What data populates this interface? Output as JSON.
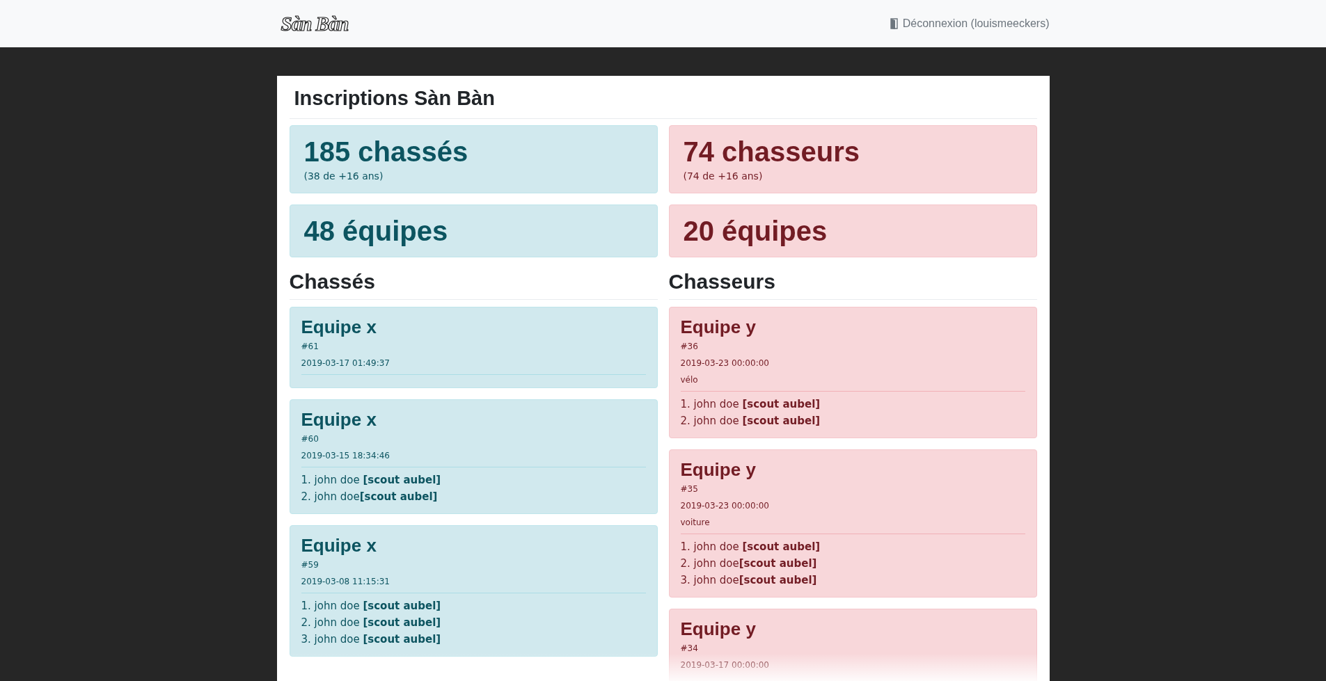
{
  "navbar": {
    "logo": "Sàn Bàn",
    "logout": "Déconnexion (louismeeckers)"
  },
  "page": {
    "title": "Inscriptions Sàn Bàn"
  },
  "columns": [
    {
      "kind": "info",
      "stats": [
        {
          "value": "185 chassés",
          "note": "(38 de +16 ans)"
        },
        {
          "value": "48 équipes"
        }
      ],
      "heading": "Chassés",
      "teams": [
        {
          "name": "Equipe x",
          "number": "#61",
          "date": "2019-03-17 01:49:37"
        },
        {
          "name": "Equipe x",
          "number": "#60",
          "date": "2019-03-15 18:34:46",
          "members": [
            "1. john doe **[scout aubel]**",
            "2. john doe**[scout aubel]**"
          ]
        },
        {
          "name": "Equipe x",
          "number": "#59",
          "date": "2019-03-08 11:15:31",
          "members": [
            "1. john doe **[scout aubel]**",
            "2. john doe **[scout aubel]**",
            "3. john doe **[scout aubel]**"
          ]
        }
      ]
    },
    {
      "kind": "danger",
      "stats": [
        {
          "value": "74 chasseurs",
          "note": "(74 de +16 ans)"
        },
        {
          "value": "20 équipes"
        }
      ],
      "heading": "Chasseurs",
      "teams": [
        {
          "name": "Equipe y",
          "number": "#36",
          "date": "2019-03-23 00:00:00",
          "vehicle": "vélo",
          "members": [
            "1. john doe **[scout aubel]**",
            "2. john doe **[scout aubel]**"
          ]
        },
        {
          "name": "Equipe y",
          "number": "#35",
          "date": "2019-03-23 00:00:00",
          "vehicle": "voiture",
          "members": [
            "1. john doe **[scout aubel]**",
            "2. john doe**[scout aubel]**",
            "3. john doe**[scout aubel]**"
          ]
        },
        {
          "name": "Equipe y",
          "number": "#34",
          "date": "2019-03-17 00:00:00"
        }
      ]
    }
  ]
}
